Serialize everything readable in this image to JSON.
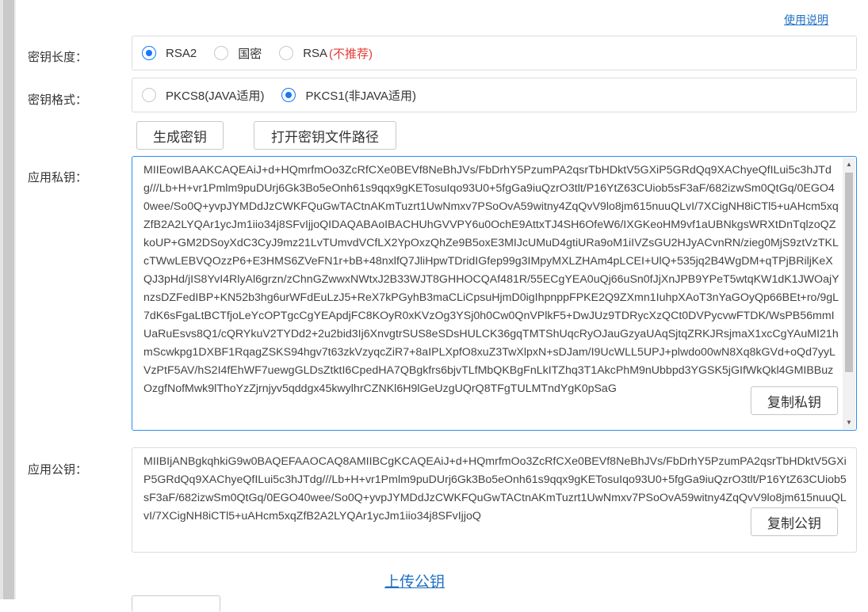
{
  "help_link": "使用说明",
  "key_length": {
    "label": "密钥长度：",
    "options": [
      {
        "label": "RSA2",
        "checked": true
      },
      {
        "label": "国密",
        "checked": false
      },
      {
        "label": "RSA",
        "checked": false,
        "note": "(不推荐)"
      }
    ]
  },
  "key_format": {
    "label": "密钥格式：",
    "options": [
      {
        "label": "PKCS8(JAVA适用)",
        "checked": false
      },
      {
        "label": "PKCS1(非JAVA适用)",
        "checked": true
      }
    ]
  },
  "actions": {
    "generate": "生成密钥",
    "open_path": "打开密钥文件路径"
  },
  "private_key": {
    "label": "应用私钥：",
    "value": "MIIEowIBAAKCAQEAiJ+d+HQmrfmOo3ZcRfCXe0BEVf8NeBhJVs/FbDrhY5PzumPA2qsrTbHDktV5GXiP5GRdQq9XAChyeQfILui5c3hJTdg///Lb+H+vr1Pmlm9puDUrj6Gk3Bo5eOnh61s9qqx9gKETosuIqo93U0+5fgGa9iuQzrO3tlt/P16YtZ63CUiob5sF3aF/682izwSm0QtGq/0EGO40wee/So0Q+yvpJYMDdJzCWKFQuGwTACtnAKmTuzrt1UwNmxv7PSoOvA59witny4ZqQvV9lo8jm615nuuQLvI/7XCigNH8iCTl5+uAHcm5xqZfB2A2LYQAr1ycJm1iio34j8SFvIjjoQIDAQABAoIBACHUhGVVPY6u0OchE9AttxTJ4SH6OfeW6/IXGKeoHM9vf1aUBNkgsWRXtDnTqlzoQZkoUP+GM2DSoyXdC3CyJ9mz21LvTUmvdVCfLX2YpOxzQhZe9B5oxE3MIJcUMuD4gtiURa9oM1iIVZsGU2HJyACvnRN/zieg0MjS9ztVzTKLcTWwLEBVQOzzP6+E3HMS6ZVeFN1r+bB+48nxlfQ7JliHpwTDridIGfep99g3IMpyMXLZHAm4pLCEI+UlQ+535jq2B4WgDM+qTPjBRiljKeXQJ3pHd/jIS8YvI4RlyAl6grzn/zChnGZwwxNWtxJ2B33WJT8GHHOCQAf481R/55ECgYEA0uQj66uSn0fJjXnJPB9YPeT5wtqKW1dK1JWOajYnzsDZFedIBP+KN52b3hg6urWFdEuLzJ5+ReX7kPGyhB3maCLiCpsuHjmD0igIhpnppFPKE2Q9ZXmn1IuhpXAoT3nYaGOyQp66BEt+ro/9gL7dK6sFgaLtBCTfjoLeYcOPTgcCgYEApdjFC8KOyR0xKVzOg3YSj0h0Cw0QnVPlkF5+DwJUz9TDRycXzQCt0DVPycvwFTDK/WsPB56mmIUaRuEsvs8Q1/cQRYkuV2TYDd2+2u2bid3Ij6XnvgtrSUS8eSDsHULCK36gqTMTShUqcRyOJauGzyaUAqSjtqZRKJRsjmaX1xcCgYAuMI21hmScwkpg1DXBF1RqagZSKS94hgv7t63zkVzyqcZiR7+8aIPLXpfO8xuZ3TwXlpxN+sDJam/I9UcWLL5UPJ+plwdo00wN8Xq8kGVd+oQd7yyLVzPtF5AV/hS2I4fEhWF7uewgGLDsZtktI6CpedHA7QBgkfrs6bjvTLfMbQKBgFnLkITZhq3T1AkcPhM9nUbbpd3YGSK5jGIfWkQkl4GMIBBuzOzgfNofMwk9lThoYzZjrnjyv5qddgx45kwylhrCZNKl6H9lGeUzgUQrQ8TFgTULMTndYgK0pSaG",
    "copy": "复制私钥"
  },
  "public_key": {
    "label": "应用公钥：",
    "value": "MIIBIjANBgkqhkiG9w0BAQEFAAOCAQ8AMIIBCgKCAQEAiJ+d+HQmrfmOo3ZcRfCXe0BEVf8NeBhJVs/FbDrhY5PzumPA2qsrTbHDktV5GXiP5GRdQq9XAChyeQfILui5c3hJTdg///Lb+H+vr1Pmlm9puDUrj6Gk3Bo5eOnh61s9qqx9gKETosuIqo93U0+5fgGa9iuQzrO3tlt/P16YtZ63CUiob5sF3aF/682izwSm0QtGq/0EGO40wee/So0Q+yvpJYMDdJzCWKFQuGwTACtnAKmTuzrt1UwNmxv7PSoOvA59witny4ZqQvV9lo8jm615nuuQLvI/7XCigNH8iCTl5+uAHcm5xqZfB2A2LYQAr1ycJm1iio34j8SFvIjjoQ",
    "copy": "复制公钥"
  },
  "upload_link": "上传公钥",
  "colors": {
    "accent": "#1677ff",
    "link": "#1f6fc5",
    "warning": "#e53935",
    "focus_border": "#2d8cf0"
  }
}
